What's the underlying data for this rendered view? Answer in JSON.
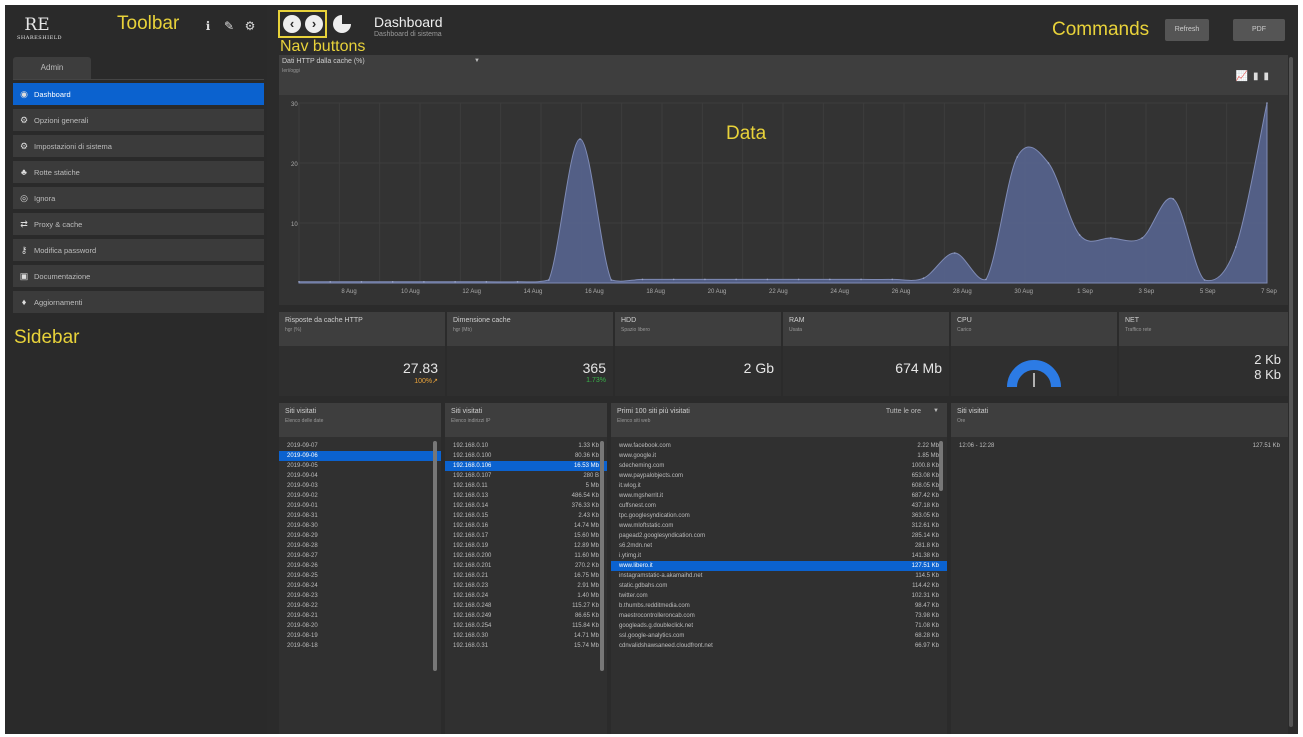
{
  "app": {
    "logo_text": "RE",
    "logo_sub": "SHARESHIELD",
    "toolbar_label": "Toolbar",
    "sidebar_label": "Sidebar",
    "nav_label": "Nav buttons",
    "commands_label": "Commands",
    "data_label": "Data"
  },
  "toolbar": {
    "icons": [
      "info-icon",
      "wrench-icon",
      "gear-icon"
    ],
    "glyphs": [
      "ℹ",
      "✎",
      "⚙"
    ]
  },
  "sidebar": {
    "tab": "Admin",
    "items": [
      {
        "label": "Dashboard",
        "glyph": "◉",
        "icon": "dashboard-icon"
      },
      {
        "label": "Opzioni generali",
        "glyph": "⚙",
        "icon": "cogs-icon"
      },
      {
        "label": "Impostazioni di sistema",
        "glyph": "⚙",
        "icon": "gear-icon"
      },
      {
        "label": "Rotte statiche",
        "glyph": "♣",
        "icon": "sitemap-icon"
      },
      {
        "label": "Ignora",
        "glyph": "◎",
        "icon": "ignore-icon"
      },
      {
        "label": "Proxy & cache",
        "glyph": "⇄",
        "icon": "exchange-icon"
      },
      {
        "label": "Modifica password",
        "glyph": "⚷",
        "icon": "key-icon"
      },
      {
        "label": "Documentazione",
        "glyph": "▣",
        "icon": "book-icon"
      },
      {
        "label": "Aggiornamenti",
        "glyph": "♦",
        "icon": "bell-icon"
      }
    ]
  },
  "header": {
    "title": "Dashboard",
    "subtitle": "Dashboard di sistema",
    "refresh": "Refresh",
    "pdf": "PDF"
  },
  "chart_panel": {
    "title": "Dati HTTP dalla cache (%)",
    "subtitle": "Ieri/oggi",
    "tool_icons": [
      "line-chart-icon",
      "bar-chart-icon"
    ]
  },
  "chart_data": {
    "type": "area",
    "title": "Dati HTTP dalla cache (%)",
    "xlabel": "",
    "ylabel": "",
    "ylim": [
      0,
      30
    ],
    "yticks": [
      10,
      20,
      30
    ],
    "xticks": [
      "8 Aug",
      "10 Aug",
      "12 Aug",
      "14 Aug",
      "16 Aug",
      "18 Aug",
      "20 Aug",
      "22 Aug",
      "24 Aug",
      "26 Aug",
      "28 Aug",
      "30 Aug",
      "1 Sep",
      "3 Sep",
      "5 Sep",
      "7 Sep"
    ],
    "x": [
      "2019-08-07",
      "2019-08-08",
      "2019-08-09",
      "2019-08-10",
      "2019-08-11",
      "2019-08-12",
      "2019-08-13",
      "2019-08-14",
      "2019-08-15",
      "2019-08-16",
      "2019-08-17",
      "2019-08-18",
      "2019-08-19",
      "2019-08-20",
      "2019-08-21",
      "2019-08-22",
      "2019-08-23",
      "2019-08-24",
      "2019-08-25",
      "2019-08-26",
      "2019-08-27",
      "2019-08-28",
      "2019-08-29",
      "2019-08-30",
      "2019-08-31",
      "2019-09-01",
      "2019-09-02",
      "2019-09-03",
      "2019-09-04",
      "2019-09-05",
      "2019-09-06",
      "2019-09-07"
    ],
    "values": [
      0.2,
      0.2,
      0.2,
      0.2,
      0.2,
      0.2,
      0.2,
      0.2,
      0.5,
      24,
      0.5,
      0.6,
      0.6,
      0.6,
      0.6,
      0.6,
      0.6,
      0.6,
      0.6,
      0.6,
      0.8,
      5,
      0.6,
      21,
      20,
      8,
      7.5,
      7.5,
      14,
      0.5,
      6,
      30
    ],
    "color": "#56648f",
    "grid": true
  },
  "tiles": [
    {
      "title": "Risposte da cache HTTP",
      "sub": "hgr (%)",
      "value": "27.83",
      "pct": "100%↗",
      "pct_color": "#e8a23a"
    },
    {
      "title": "Dimensione cache",
      "sub": "hgr (Mb)",
      "value": "365",
      "pct": "1.73%",
      "pct_color": "#39b54a"
    },
    {
      "title": "HDD",
      "sub": "Spazio libero",
      "value": "2 Gb"
    },
    {
      "title": "RAM",
      "sub": "Usata",
      "value": "674 Mb"
    },
    {
      "title": "CPU",
      "sub": "Carico",
      "gauge_level": 0.5
    },
    {
      "title": "NET",
      "sub": "Traffico rete",
      "in": "2 Kb",
      "out": "8 Kb"
    }
  ],
  "lists": {
    "dates": {
      "title": "Siti visitati",
      "sub": "Elenco delle date",
      "rows": [
        "2019-09-07",
        "2019-09-06",
        "2019-09-05",
        "2019-09-04",
        "2019-09-03",
        "2019-09-02",
        "2019-09-01",
        "2019-08-31",
        "2019-08-30",
        "2019-08-29",
        "2019-08-28",
        "2019-08-27",
        "2019-08-26",
        "2019-08-25",
        "2019-08-24",
        "2019-08-23",
        "2019-08-22",
        "2019-08-21",
        "2019-08-20",
        "2019-08-19",
        "2019-08-18"
      ],
      "selected": 1
    },
    "ips": {
      "title": "Siti visitati",
      "sub": "Elenco indirizzi IP",
      "rows": [
        [
          "192.168.0.10",
          "1.33 Kb"
        ],
        [
          "192.168.0.100",
          "80.36 Kb"
        ],
        [
          "192.168.0.106",
          "16.53 Mb"
        ],
        [
          "192.168.0.107",
          "280 B"
        ],
        [
          "192.168.0.11",
          "5 Mb"
        ],
        [
          "192.168.0.13",
          "486.54 Kb"
        ],
        [
          "192.168.0.14",
          "376.33 Kb"
        ],
        [
          "192.168.0.15",
          "2.43 Kb"
        ],
        [
          "192.168.0.16",
          "14.74 Mb"
        ],
        [
          "192.168.0.17",
          "15.60 Mb"
        ],
        [
          "192.168.0.19",
          "12.89 Mb"
        ],
        [
          "192.168.0.200",
          "11.60 Mb"
        ],
        [
          "192.168.0.201",
          "270.2 Kb"
        ],
        [
          "192.168.0.21",
          "16.75 Mb"
        ],
        [
          "192.168.0.23",
          "2.91 Mb"
        ],
        [
          "192.168.0.24",
          "1.40 Mb"
        ],
        [
          "192.168.0.248",
          "115.27 Kb"
        ],
        [
          "192.168.0.249",
          "86.65 Kb"
        ],
        [
          "192.168.0.254",
          "115.84 Kb"
        ],
        [
          "192.168.0.30",
          "14.71 Mb"
        ],
        [
          "192.168.0.31",
          "15.74 Mb"
        ]
      ],
      "selected": 2
    },
    "sites": {
      "title": "Primi 100 siti più visitati",
      "sub": "Elenco siti web",
      "select": "Tutte le ore",
      "rows": [
        [
          "www.facebook.com",
          "2.22 Mb"
        ],
        [
          "www.google.it",
          "1.85 Mb"
        ],
        [
          "sdecheming.com",
          "1000.8 Kb"
        ],
        [
          "www.paypalobjects.com",
          "653.08 Kb"
        ],
        [
          "it.wlog.it",
          "608.05 Kb"
        ],
        [
          "www.mgsherrit.it",
          "687.42 Kb"
        ],
        [
          "cuffsnest.com",
          "437.18 Kb"
        ],
        [
          "tpc.googlesyndication.com",
          "363.05 Kb"
        ],
        [
          "www.mloftstatic.com",
          "312.61 Kb"
        ],
        [
          "pagead2.googlesyndication.com",
          "285.14 Kb"
        ],
        [
          "s6.2mdn.net",
          "281.8 Kb"
        ],
        [
          "i.ytimg.it",
          "141.38 Kb"
        ],
        [
          "www.libero.it",
          "127.51 Kb"
        ],
        [
          "instagramstatic-a.akamaihd.net",
          "114.5 Kb"
        ],
        [
          "static.gdbahs.com",
          "114.42 Kb"
        ],
        [
          "twitter.com",
          "102.31 Kb"
        ],
        [
          "b.thumbs.redditmedia.com",
          "98.47 Kb"
        ],
        [
          "maestrocontrolleroncab.com",
          "73.98 Kb"
        ],
        [
          "googleads.g.doubleclick.net",
          "71.08 Kb"
        ],
        [
          "ssl.google-analytics.com",
          "68.28 Kb"
        ],
        [
          "cdnvalidshawsaneed.cloudfront.net",
          "66.97 Kb"
        ]
      ],
      "selected": 12
    },
    "visits": {
      "title": "Siti visitati",
      "sub": "Ore",
      "rows": [
        [
          "12:06 - 12:28",
          "127.51 Kb"
        ]
      ]
    }
  }
}
